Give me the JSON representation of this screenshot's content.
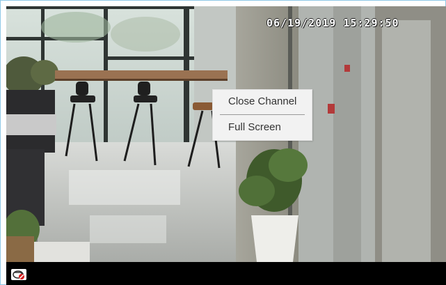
{
  "video": {
    "timestamp": "06/19/2019  15:29:50",
    "scene": "camera-live-view"
  },
  "context_menu": {
    "items": [
      {
        "label": "Close Channel"
      },
      {
        "label": "Full Screen"
      }
    ]
  },
  "toolbar": {
    "icon": "recording-disabled-icon"
  },
  "colors": {
    "frame_border": "#8fc9e6",
    "toolbar_bg": "#000000",
    "menu_bg": "#f2f2f2"
  }
}
